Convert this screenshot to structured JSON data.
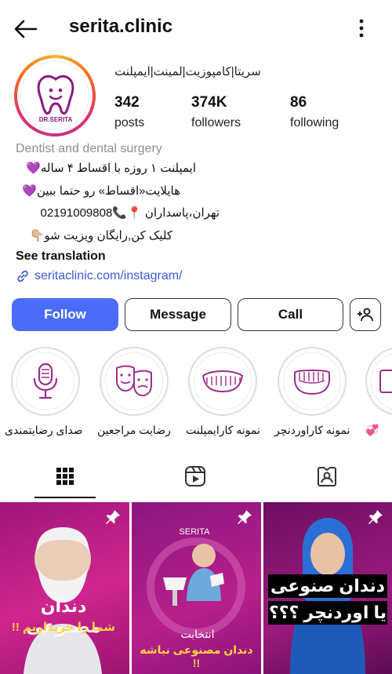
{
  "header": {
    "username": "serita.clinic"
  },
  "profile": {
    "avatar_text": "DR.SERITA",
    "title": "سریتا|کامپوزیت|لمینت|ایمپلنت",
    "stats": [
      {
        "value": "342",
        "label": "posts"
      },
      {
        "value": "374K",
        "label": "followers"
      },
      {
        "value": "86",
        "label": "following"
      }
    ],
    "category": "Dentist and dental surgery",
    "bio": [
      "ایمپلنت ۱ روزه با اقساط ۴ ساله💜",
      "هایلایت«اقساط» رو حتما ببین💜",
      "تهران،پاسداران 📍📞02191009808",
      "کلیک کن,رایگان ویزیت شو👇🏼"
    ],
    "see_translation": "See translation",
    "link": "seritaclinic.com/instagram/"
  },
  "actions": {
    "follow": "Follow",
    "message": "Message",
    "call": "Call"
  },
  "highlights": [
    {
      "label": "صدای رضایتمندی",
      "icon": "microphone-icon"
    },
    {
      "label": "رضایت مراجعین",
      "icon": "theater-masks-icon"
    },
    {
      "label": "نمونه کارایمپلنت",
      "icon": "teeth-icon"
    },
    {
      "label": "نمونه کاراوردنچر",
      "icon": "denture-icon"
    },
    {
      "label": "💞",
      "icon": "device-icon"
    }
  ],
  "tabs": [
    {
      "name": "grid-icon"
    },
    {
      "name": "reels-icon"
    },
    {
      "name": "tagged-icon"
    }
  ],
  "posts": [
    {
      "line1": "دندان مصنوعی",
      "line2": "شما را خریداریم !!"
    },
    {
      "brand": "SERITA",
      "line1": "انتخابت",
      "line2": "دندان مصنوعی نباشه !!"
    },
    {
      "line1": "دندان صنوعی",
      "line2": "یا اوردنچر ؟؟؟"
    }
  ],
  "colors": {
    "accent": "#4a6cf7",
    "link": "#3b5bdb",
    "highlight_purple": "#9b2d8f"
  }
}
